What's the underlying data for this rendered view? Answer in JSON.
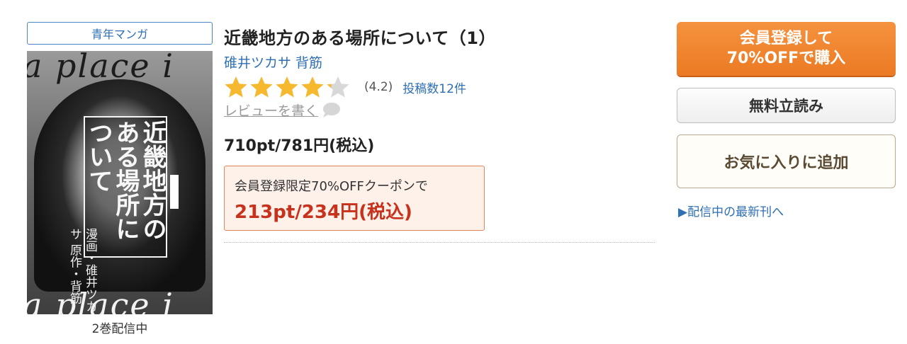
{
  "genre_badge": "青年マンガ",
  "cover": {
    "bg_text_top": "a place i",
    "bg_text_bottom": "a place i",
    "vertical_title": "近畿地方のある場所について",
    "vertical_author": "漫画・碓井ツカサ 原作・背筋"
  },
  "volumes_text": "2巻配信中",
  "title": "近畿地方のある場所について（1）",
  "authors": "碓井ツカサ 背筋",
  "rating": {
    "value": 4.2,
    "value_text": "(4.2)",
    "review_count_text": "投稿数12件",
    "star_color": "#f5b82e",
    "empty_star_color": "#d8d8d8"
  },
  "write_review_label": "レビューを書く",
  "price": "710pt/781円(税込)",
  "coupon": {
    "label": "会員登録限定70%OFFクーポンで",
    "price": "213pt/234円(税込)"
  },
  "buttons": {
    "buy_line1": "会員登録して",
    "buy_line2": "70%OFFで購入",
    "trial": "無料立読み",
    "favorite": "お気に入りに追加"
  },
  "latest_link": "▶配信中の最新刊へ",
  "colors": {
    "accent_orange": "#ec7a24",
    "link_blue": "#2f6fb3",
    "coupon_red": "#c8321c"
  }
}
